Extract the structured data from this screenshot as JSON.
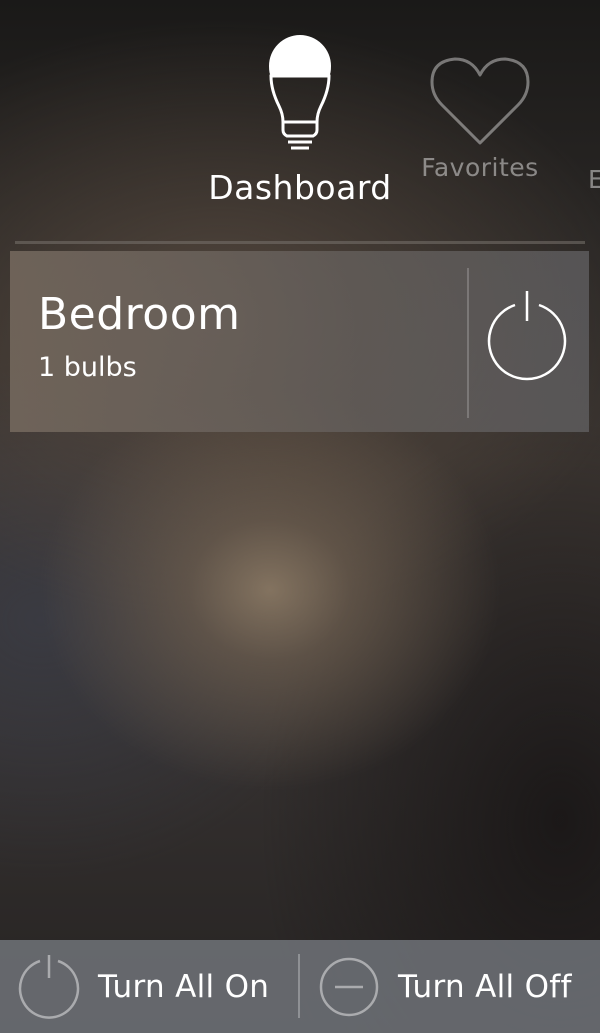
{
  "tabs": [
    {
      "label": "Dashboard",
      "icon": "lightbulb-icon",
      "active": true
    },
    {
      "label": "Favorites",
      "icon": "heart-icon",
      "active": false
    },
    {
      "label": "E",
      "icon": "",
      "active": false
    }
  ],
  "rooms": [
    {
      "name": "Bedroom",
      "bulbs": "1 bulbs",
      "icon": "power-icon"
    }
  ],
  "bottom_bar": {
    "turn_all_on": "Turn All On",
    "turn_all_off": "Turn All Off",
    "on_icon": "power-icon",
    "off_icon": "minus-circle-icon"
  },
  "colors": {
    "card": "#6e6560",
    "bottom_bar": "#73767c",
    "text": "#ffffff",
    "inactive_text": "#8a8784"
  }
}
